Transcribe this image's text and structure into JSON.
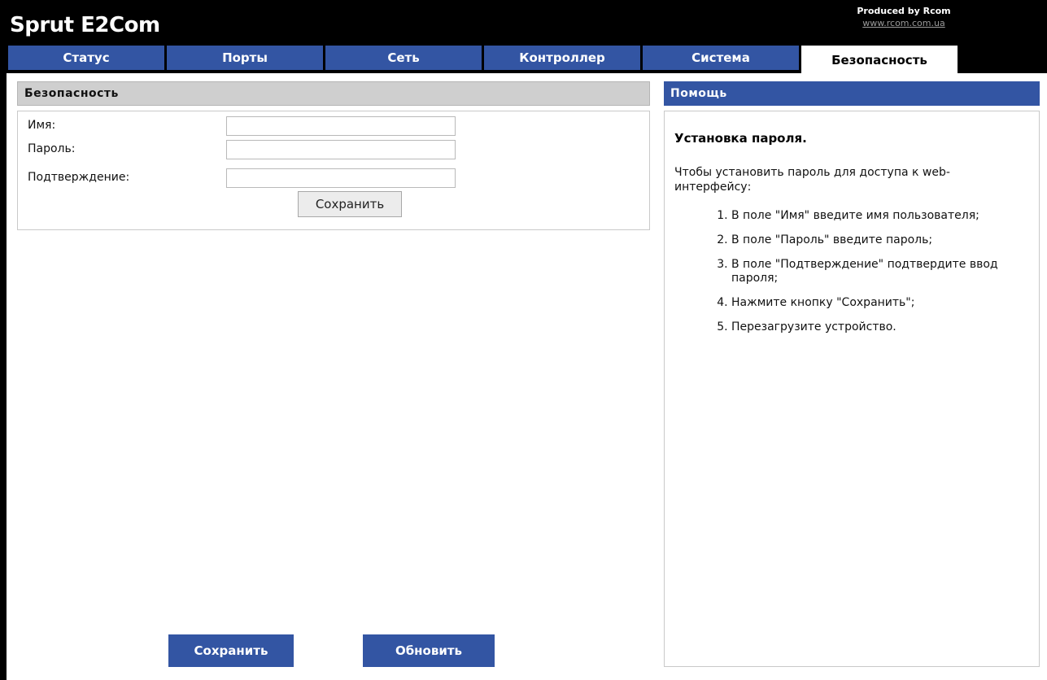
{
  "header": {
    "brand": "Sprut E2Com",
    "produced_by": "Produced by Rcom",
    "url": "www.rcom.com.ua"
  },
  "tabs": [
    {
      "label": "Статус"
    },
    {
      "label": "Порты"
    },
    {
      "label": "Сеть"
    },
    {
      "label": "Контроллер"
    },
    {
      "label": "Система"
    },
    {
      "label": "Безопасность",
      "active": true
    }
  ],
  "security": {
    "title": "Безопасность",
    "name_label": "Имя:",
    "name_value": "",
    "password_label": "Пароль:",
    "password_value": "",
    "confirm_label": "Подтверждение:",
    "confirm_value": "",
    "save_button": "Сохранить"
  },
  "help": {
    "title": "Помощь",
    "heading": "Установка пароля.",
    "intro": "Чтобы установить пароль для доступа к web-интерфейсу:",
    "steps": [
      "В поле \"Имя\" введите имя пользователя;",
      "В поле \"Пароль\" введите пароль;",
      "В поле \"Подтверждение\" подтвердите ввод пароля;",
      "Нажмите кнопку \"Сохранить\";",
      "Перезагрузите устройство."
    ]
  },
  "footer": {
    "save_button": "Сохранить",
    "refresh_button": "Обновить"
  },
  "colors": {
    "accent_blue": "#3355a3",
    "header_bg": "#000000",
    "section_gray": "#cfcfcf"
  }
}
